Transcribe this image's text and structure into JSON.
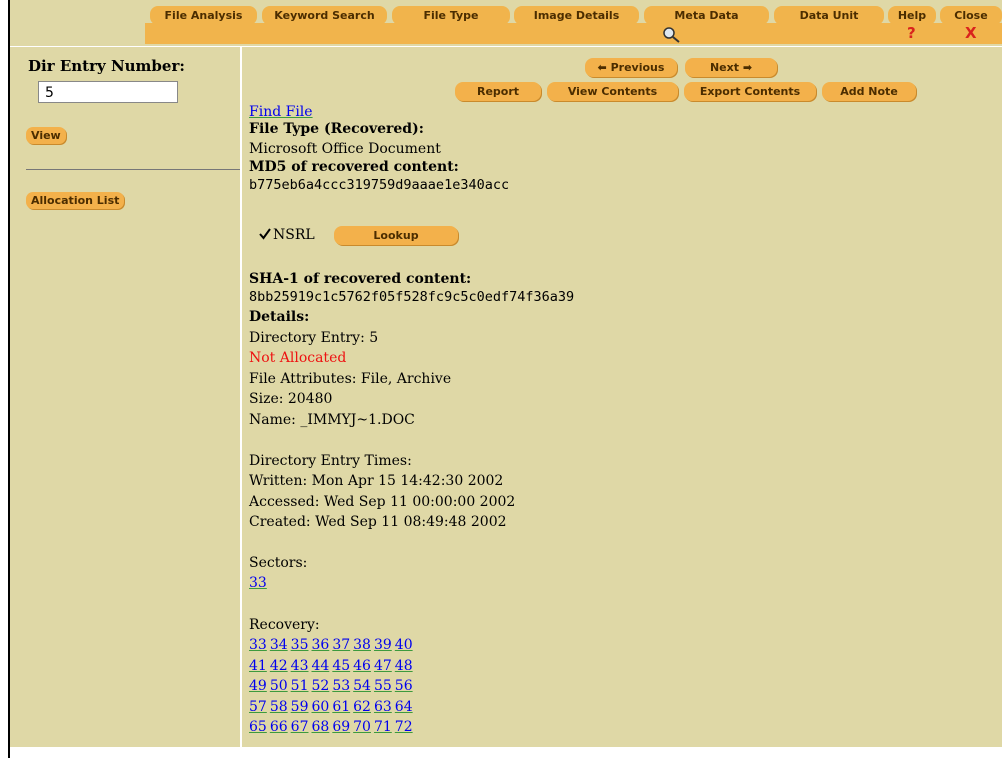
{
  "nav": {
    "tabs": [
      "File Analysis",
      "Keyword Search",
      "File Type",
      "Image Details",
      "Meta Data",
      "Data Unit",
      "Help",
      "Close"
    ],
    "help_symbol": "?",
    "close_symbol": "X"
  },
  "sidebar": {
    "dir_entry_label": "Dir Entry Number:",
    "dir_entry_value": "5",
    "view_button": "View",
    "allocation_list_button": "Allocation List"
  },
  "toolbar": {
    "previous": "Previous",
    "next": "Next",
    "report": "Report",
    "view_contents": "View Contents",
    "export_contents": "Export Contents",
    "add_note": "Add Note"
  },
  "content": {
    "find_file": "Find File",
    "file_type_label": "File Type (Recovered):",
    "file_type_value": "Microsoft Office Document",
    "md5_label": "MD5 of recovered content:",
    "md5_value": "b775eb6a4ccc319759d9aaae1e340acc",
    "nsrl_label": "NSRL",
    "nsrl_checked": true,
    "lookup_button": "Lookup",
    "sha1_label": "SHA-1 of recovered content:",
    "sha1_value": "8bb25919c1c5762f05f528fc9c5c0edf74f36a39",
    "details_label": "Details:",
    "directory_entry": "Directory Entry: 5",
    "allocation_status": "Not Allocated",
    "file_attributes": "File Attributes: File, Archive",
    "size": "Size: 20480",
    "name": "Name: _IMMYJ~1.DOC",
    "times_label": "Directory Entry Times:",
    "written": "Written: Mon Apr 15 14:42:30 2002",
    "accessed": "Accessed: Wed Sep 11 00:00:00 2002",
    "created": "Created: Wed Sep 11 08:49:48 2002",
    "sectors_label": "Sectors:",
    "sectors": [
      "33"
    ],
    "recovery_label": "Recovery:",
    "recovery_rows": [
      [
        "33",
        "34",
        "35",
        "36",
        "37",
        "38",
        "39",
        "40"
      ],
      [
        "41",
        "42",
        "43",
        "44",
        "45",
        "46",
        "47",
        "48"
      ],
      [
        "49",
        "50",
        "51",
        "52",
        "53",
        "54",
        "55",
        "56"
      ],
      [
        "57",
        "58",
        "59",
        "60",
        "61",
        "62",
        "63",
        "64"
      ],
      [
        "65",
        "66",
        "67",
        "68",
        "69",
        "70",
        "71",
        "72"
      ]
    ]
  },
  "colors": {
    "panel_bg": "#dfd8a6",
    "button_bg": "#f3b14b",
    "button_text": "#4b2d00",
    "link": "#0000ee",
    "alert": "#ee1111"
  }
}
